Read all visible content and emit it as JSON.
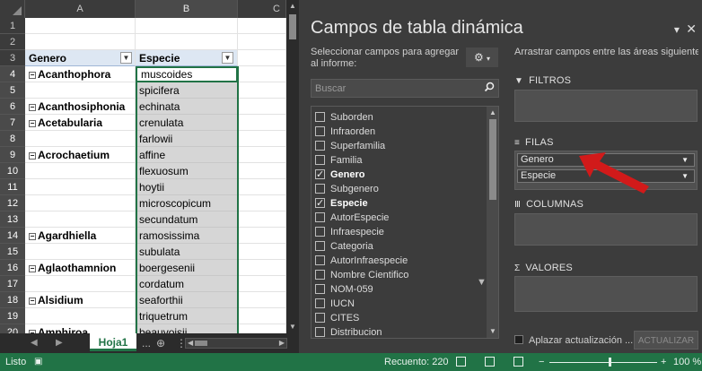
{
  "sheet": {
    "columns": [
      "A",
      "B",
      "C"
    ],
    "row_numbers": [
      "1",
      "2",
      "3",
      "4",
      "5",
      "6",
      "7",
      "8",
      "9",
      "10",
      "11",
      "12",
      "13",
      "14",
      "15",
      "16",
      "17",
      "18",
      "19",
      "20"
    ],
    "pivot_header": {
      "genero": "Genero",
      "especie": "Especie"
    },
    "rows": [
      {
        "a": "",
        "b": ""
      },
      {
        "a": "",
        "b": ""
      },
      {
        "a": "Genero",
        "b": "Especie",
        "hdr": true
      },
      {
        "a": "Acanthophora",
        "b": "muscoides",
        "g": true
      },
      {
        "a": "",
        "b": "spicifera"
      },
      {
        "a": "Acanthosiphonia",
        "b": "echinata",
        "g": true
      },
      {
        "a": "Acetabularia",
        "b": "crenulata",
        "g": true
      },
      {
        "a": "",
        "b": "farlowii"
      },
      {
        "a": "Acrochaetium",
        "b": "affine",
        "g": true
      },
      {
        "a": "",
        "b": "flexuosum"
      },
      {
        "a": "",
        "b": "hoytii"
      },
      {
        "a": "",
        "b": "microscopicum"
      },
      {
        "a": "",
        "b": "secundatum"
      },
      {
        "a": "Agardhiella",
        "b": "ramosissima",
        "g": true
      },
      {
        "a": "",
        "b": "subulata"
      },
      {
        "a": "Aglaothamnion",
        "b": "boergesenii",
        "g": true
      },
      {
        "a": "",
        "b": "cordatum"
      },
      {
        "a": "Alsidium",
        "b": "seaforthii",
        "g": true
      },
      {
        "a": "",
        "b": "triquetrum"
      },
      {
        "a": "Amphiroa",
        "b": "beauvoisii",
        "g": true
      }
    ]
  },
  "tabs": {
    "sheet_name": "Hoja1",
    "more": "...",
    "add": "⊕",
    "menu": "⋮"
  },
  "pane": {
    "title": "Campos de tabla dinámica",
    "instruction_left": "Seleccionar campos para agregar al informe:",
    "search_placeholder": "Buscar",
    "fields": [
      {
        "label": "Suborden",
        "checked": false
      },
      {
        "label": "Infraorden",
        "checked": false
      },
      {
        "label": "Superfamilia",
        "checked": false
      },
      {
        "label": "Familia",
        "checked": false
      },
      {
        "label": "Genero",
        "checked": true
      },
      {
        "label": "Subgenero",
        "checked": false
      },
      {
        "label": "Especie",
        "checked": true
      },
      {
        "label": "AutorEspecie",
        "checked": false
      },
      {
        "label": "Infraespecie",
        "checked": false
      },
      {
        "label": "Categoria",
        "checked": false
      },
      {
        "label": "AutorInfraespecie",
        "checked": false
      },
      {
        "label": "Nombre Cientifico",
        "checked": false
      },
      {
        "label": "NOM-059",
        "checked": false
      },
      {
        "label": "IUCN",
        "checked": false
      },
      {
        "label": "CITES",
        "checked": false
      },
      {
        "label": "Distribucion",
        "checked": false
      }
    ],
    "instruction_right": "Arrastrar campos entre las áreas siguientes:",
    "areas": {
      "filters": "FILTROS",
      "rows": "FILAS",
      "columns": "COLUMNAS",
      "values": "VALORES"
    },
    "row_items": [
      "Genero",
      "Especie"
    ],
    "defer_label": "Aplazar actualización ...",
    "update_button": "ACTUALIZAR"
  },
  "status": {
    "left": "Listo",
    "count": "Recuento: 220",
    "zoom": "100 %",
    "zoom_minus": "−",
    "zoom_plus": "+"
  },
  "colors": {
    "excel_green": "#217346",
    "arrow_red": "#d11a1a"
  }
}
